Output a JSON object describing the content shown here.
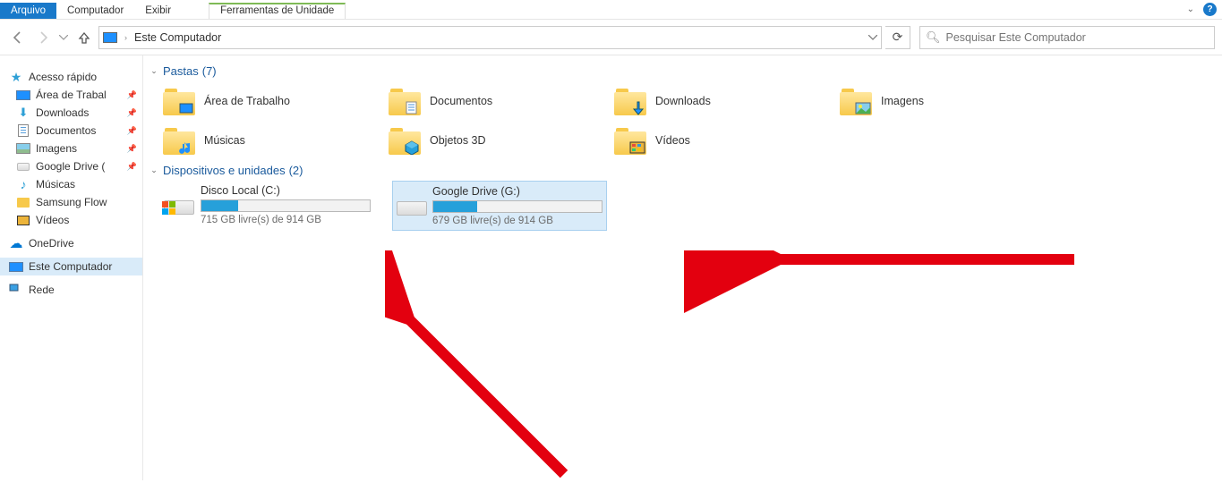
{
  "tabs": {
    "file": "Arquivo",
    "computer": "Computador",
    "view": "Exibir",
    "drive_tools": "Ferramentas de Unidade"
  },
  "address": {
    "location": "Este Computador"
  },
  "search": {
    "placeholder": "Pesquisar Este Computador"
  },
  "sidebar": {
    "quick_access": "Acesso rápido",
    "items": [
      {
        "label": "Área de Trabal",
        "pinned": true
      },
      {
        "label": "Downloads",
        "pinned": true
      },
      {
        "label": "Documentos",
        "pinned": true
      },
      {
        "label": "Imagens",
        "pinned": true
      },
      {
        "label": "Google Drive (",
        "pinned": true
      },
      {
        "label": "Músicas",
        "pinned": false
      },
      {
        "label": "Samsung Flow",
        "pinned": false
      },
      {
        "label": "Vídeos",
        "pinned": false
      }
    ],
    "onedrive": "OneDrive",
    "this_pc": "Este Computador",
    "network": "Rede"
  },
  "groups": {
    "folders": {
      "title": "Pastas",
      "count": "(7)",
      "items": [
        {
          "label": "Área de Trabalho",
          "overlay": "desk"
        },
        {
          "label": "Documentos",
          "overlay": "doc"
        },
        {
          "label": "Downloads",
          "overlay": "dl"
        },
        {
          "label": "Imagens",
          "overlay": "img"
        },
        {
          "label": "Músicas",
          "overlay": "music"
        },
        {
          "label": "Objetos 3D",
          "overlay": "cube"
        },
        {
          "label": "Vídeos",
          "overlay": "video"
        }
      ]
    },
    "drives": {
      "title": "Dispositivos e unidades",
      "count": "(2)",
      "items": [
        {
          "name": "Disco Local (C:)",
          "info": "715 GB livre(s) de 914 GB",
          "fill": 22,
          "win": true,
          "selected": false
        },
        {
          "name": "Google Drive (G:)",
          "info": "679 GB livre(s) de 914 GB",
          "fill": 26,
          "win": false,
          "selected": true
        }
      ]
    }
  }
}
